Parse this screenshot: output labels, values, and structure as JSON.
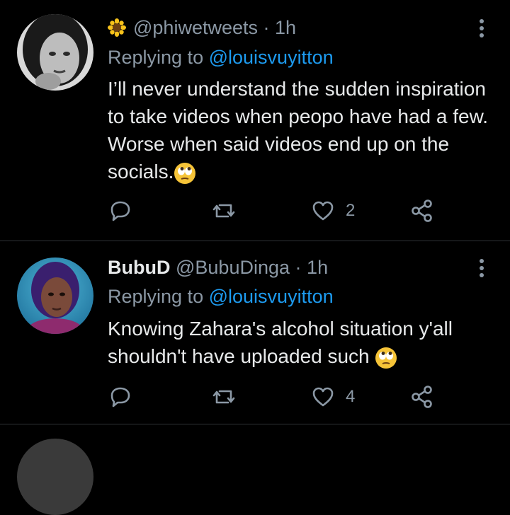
{
  "tweets": [
    {
      "emoji_name": "sunflower-icon",
      "handle": "@phiwetweets",
      "separator": "·",
      "time": "1h",
      "replying_prefix": "Replying to",
      "replying_to": "@louisvuyitton",
      "text": "I’ll never understand the sudden inspiration to take videos when peopo have had a few. Worse when said videos end up on the socials.",
      "text_emoji": "face-with-rolling-eyes-icon",
      "replies": "",
      "retweets": "",
      "likes": "2"
    },
    {
      "display_name": "BubuD",
      "handle": "@BubuDinga",
      "separator": "·",
      "time": "1h",
      "replying_prefix": "Replying to",
      "replying_to": "@louisvuyitton",
      "text": "Knowing Zahara's alcohol situation y'all shouldn't have uploaded such",
      "text_emoji": "face-with-rolling-eyes-icon",
      "replies": "",
      "retweets": "",
      "likes": "4"
    }
  ],
  "colors": {
    "background": "#000000",
    "text": "#e7e9ea",
    "secondary": "#8b98a5",
    "link": "#1d9bf0",
    "divider": "#2f3336"
  }
}
